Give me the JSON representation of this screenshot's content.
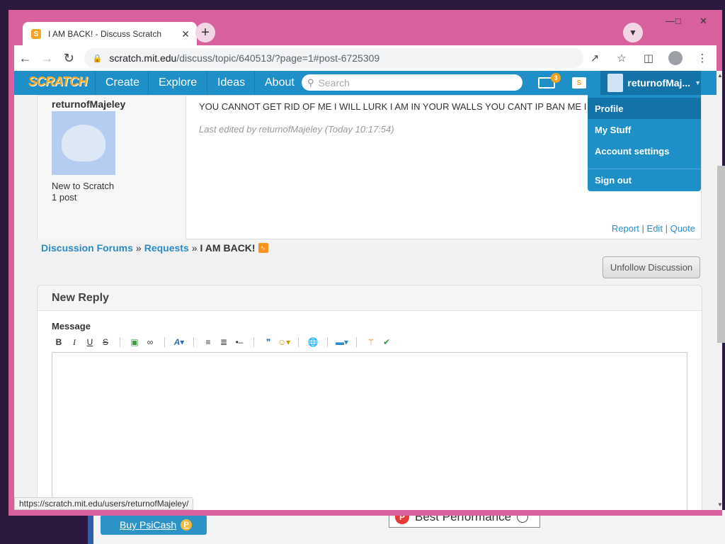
{
  "browser": {
    "tab_title": "I AM BACK! - Discuss Scratch",
    "tab_close": "✕",
    "new_tab": "+",
    "url_host": "scratch.mit.edu",
    "url_path": "/discuss/topic/640513/?page=1#post-6725309",
    "status_url": "https://scratch.mit.edu/users/returnofMajeley/"
  },
  "nav": {
    "logo": "SCRATCH",
    "links": [
      "Create",
      "Explore",
      "Ideas",
      "About"
    ],
    "search_placeholder": "Search",
    "message_count": "3",
    "username": "returnofMaj..."
  },
  "dropdown": {
    "items": [
      "Profile",
      "My Stuff",
      "Account settings",
      "Sign out"
    ],
    "active": "Profile"
  },
  "post": {
    "author": "returnofMajeley",
    "rank": "New to Scratch",
    "post_count": "1 post",
    "body": "YOU CANNOT GET RID OF ME I WILL LURK I AM IN YOUR WALLS YOU CANT IP BAN ME I",
    "edit_note": "Last edited by returnofMajeley (Today 10:17:54)",
    "actions": [
      "Report",
      "Edit",
      "Quote"
    ],
    "action_separator": "|"
  },
  "breadcrumbs": {
    "items": [
      "Discussion Forums",
      "Requests"
    ],
    "separator": "»",
    "current": "I AM BACK!"
  },
  "unfollow_label": "Unfollow Discussion",
  "reply": {
    "title": "New Reply",
    "message_label": "Message",
    "toolbar": [
      "B",
      "I",
      "U",
      "S"
    ]
  },
  "desktop": {
    "psicash_label": "Buy PsiCash",
    "best_performance": "Best Performance"
  },
  "colors": {
    "nav_blue": "#1f8fc8",
    "window_frame": "#d8609c",
    "link_blue": "#2c8bc8"
  }
}
